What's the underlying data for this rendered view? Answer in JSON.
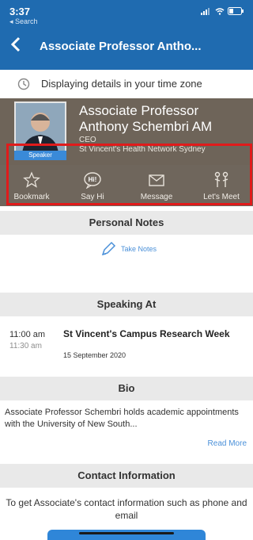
{
  "status_bar": {
    "time": "3:37",
    "back_label": "◂ Search"
  },
  "nav": {
    "title": "Associate Professor Antho..."
  },
  "timezone": {
    "text": "Displaying details in your time zone"
  },
  "profile": {
    "name": "Associate Professor Anthony Schembri AM",
    "role": "CEO",
    "organization": "St Vincent's Health Network Sydney",
    "badge": "Speaker"
  },
  "actions": [
    {
      "label": "Bookmark",
      "icon": "star-icon"
    },
    {
      "label": "Say Hi",
      "icon": "hi-bubble-icon"
    },
    {
      "label": "Message",
      "icon": "envelope-icon"
    },
    {
      "label": "Let's Meet",
      "icon": "meet-people-icon"
    }
  ],
  "personal_notes": {
    "heading": "Personal Notes",
    "take_notes": "Take Notes"
  },
  "speaking_at": {
    "heading": "Speaking At",
    "session": {
      "start": "11:00 am",
      "end": "11:30 am",
      "title": "St Vincent's Campus Research Week",
      "date": "15 September 2020"
    }
  },
  "bio": {
    "heading": "Bio",
    "text": "Associate Professor Schembri holds academic appointments with the University of New South...",
    "read_more": "Read More"
  },
  "contact": {
    "heading": "Contact Information",
    "text": "To get Associate's contact information such as phone and email"
  },
  "colors": {
    "nav_blue": "#1f6bb0",
    "profile_brown": "#6e6459",
    "link_blue": "#4a90d9",
    "highlight_red": "#e01b1b"
  }
}
